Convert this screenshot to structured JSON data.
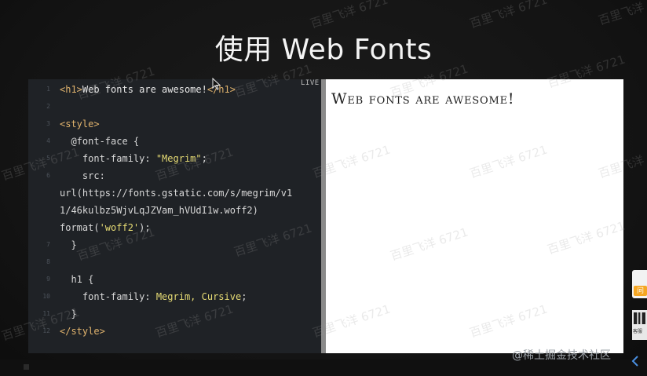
{
  "slide": {
    "title": "使用 Web Fonts"
  },
  "editor": {
    "live_label": "LIVE",
    "lines": [
      {
        "n": "1",
        "parts": [
          {
            "c": "tag",
            "t": "<h1>"
          },
          {
            "c": "str",
            "t": "Web fonts are awesome!"
          },
          {
            "c": "tag",
            "t": "</h1>"
          }
        ]
      },
      {
        "n": "2",
        "parts": [
          {
            "c": "str",
            "t": ""
          }
        ]
      },
      {
        "n": "3",
        "parts": [
          {
            "c": "tag",
            "t": "<style>"
          }
        ]
      },
      {
        "n": "4",
        "parts": [
          {
            "c": "kw",
            "t": "  @font-face {"
          }
        ]
      },
      {
        "n": "5",
        "parts": [
          {
            "c": "kw",
            "t": "    font-family: "
          },
          {
            "c": "val",
            "t": "\"Megrim\""
          },
          {
            "c": "kw",
            "t": ";"
          }
        ]
      },
      {
        "n": "6",
        "parts": [
          {
            "c": "kw",
            "t": "    src:"
          }
        ]
      },
      {
        "n": "",
        "parts": [
          {
            "c": "kw",
            "t": "url(https://fonts.gstatic.com/s/megrim/v1"
          }
        ]
      },
      {
        "n": "",
        "parts": [
          {
            "c": "kw",
            "t": "1/46kulbz5WjvLqJZVam_hVUdI1w.woff2)"
          }
        ]
      },
      {
        "n": "",
        "parts": [
          {
            "c": "kw",
            "t": "format("
          },
          {
            "c": "val",
            "t": "'woff2'"
          },
          {
            "c": "kw",
            "t": ");"
          }
        ]
      },
      {
        "n": "7",
        "parts": [
          {
            "c": "kw",
            "t": "  }"
          }
        ]
      },
      {
        "n": "8",
        "parts": [
          {
            "c": "str",
            "t": ""
          }
        ]
      },
      {
        "n": "9",
        "parts": [
          {
            "c": "kw",
            "t": "  h1 {"
          }
        ]
      },
      {
        "n": "10",
        "parts": [
          {
            "c": "kw",
            "t": "    font-family: "
          },
          {
            "c": "val",
            "t": "Megrim, Cursive"
          },
          {
            "c": "kw",
            "t": ";"
          }
        ]
      },
      {
        "n": "11",
        "parts": [
          {
            "c": "kw",
            "t": "  }"
          }
        ]
      },
      {
        "n": "12",
        "parts": [
          {
            "c": "tag",
            "t": "</style>"
          }
        ]
      }
    ]
  },
  "preview": {
    "heading": "Web fonts are awesome!"
  },
  "side_widgets": {
    "ask_label": "问",
    "qr_caption": "客服"
  },
  "watermark": {
    "repeat_text": "百里飞洋 6721",
    "site_text": "@稀土掘金技术社区"
  },
  "colors": {
    "background": "#141414",
    "editor_bg": "#1f2226",
    "tag": "#e0b36d",
    "string_value": "#e6db74",
    "preview_bg": "#ffffff"
  }
}
